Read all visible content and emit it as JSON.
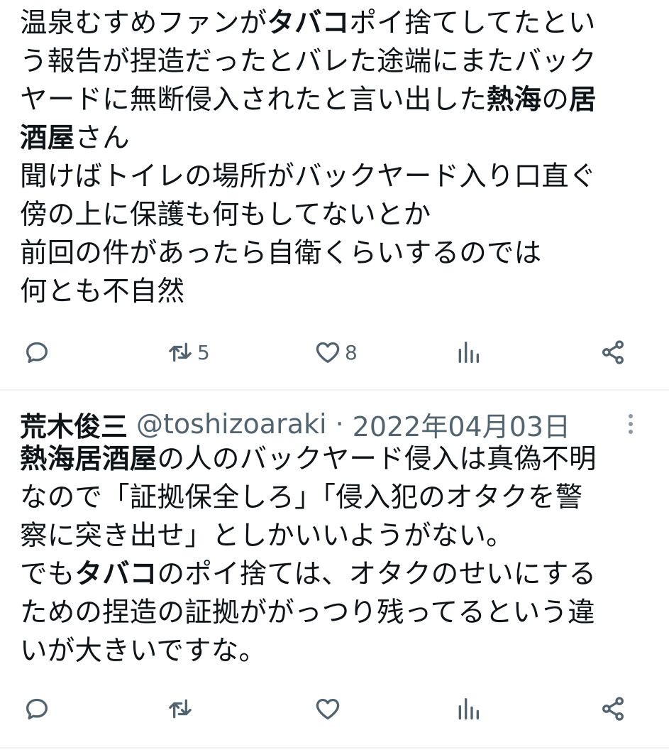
{
  "post1": {
    "lines": [
      [
        {
          "t": "温泉むすめファンが"
        },
        {
          "t": "タバコ",
          "b": true
        },
        {
          "t": "ポイ捨てしてたとい"
        }
      ],
      [
        {
          "t": "う報告が捏造だったとバレた途端にまたバック"
        }
      ],
      [
        {
          "t": "ヤードに無断侵入されたと言い出した"
        },
        {
          "t": "熱海",
          "b": true
        },
        {
          "t": "の"
        },
        {
          "t": "居",
          "b": true
        }
      ],
      [
        {
          "t": "酒屋",
          "b": true
        },
        {
          "t": "さん"
        }
      ],
      [
        {
          "t": "聞けばトイレの場所がバックヤード入り口直ぐ"
        }
      ],
      [
        {
          "t": "傍の上に保護も何もしてないとか"
        }
      ],
      [
        {
          "t": "前回の件があったら自衛くらいするのでは"
        }
      ],
      [
        {
          "t": "何とも不自然"
        }
      ]
    ],
    "actions": {
      "reply": "",
      "retweet": "5",
      "like": "8",
      "views": ""
    }
  },
  "post2": {
    "author_name": "荒木俊三",
    "handle": "@toshizoaraki",
    "separator": "·",
    "date": "2022年04月03日",
    "lines": [
      [
        {
          "t": "熱海居酒屋",
          "b": true
        },
        {
          "t": "の人のバックヤード侵入は真偽不明"
        }
      ],
      [
        {
          "t": "なので「証拠保全しろ」「侵入犯のオタクを警"
        }
      ],
      [
        {
          "t": "察に突き出せ」としかいいようがない。"
        }
      ],
      [
        {
          "t": "でも"
        },
        {
          "t": "タバコ",
          "b": true
        },
        {
          "t": "のポイ捨ては、オタクのせいにする"
        }
      ],
      [
        {
          "t": "ための捏造の証拠ががっつり残ってるという違"
        }
      ],
      [
        {
          "t": "いが大きいですな。"
        }
      ]
    ],
    "actions": {
      "reply": "",
      "retweet": "",
      "like": "",
      "views": ""
    }
  },
  "icons": {
    "reply": "reply-icon",
    "retweet": "retweet-icon",
    "like": "heart-icon",
    "views": "views-icon",
    "share": "share-icon",
    "more": "more-vertical-icon"
  },
  "colors": {
    "text": "#0f1419",
    "muted": "#536471",
    "divider": "#eff3f4"
  }
}
